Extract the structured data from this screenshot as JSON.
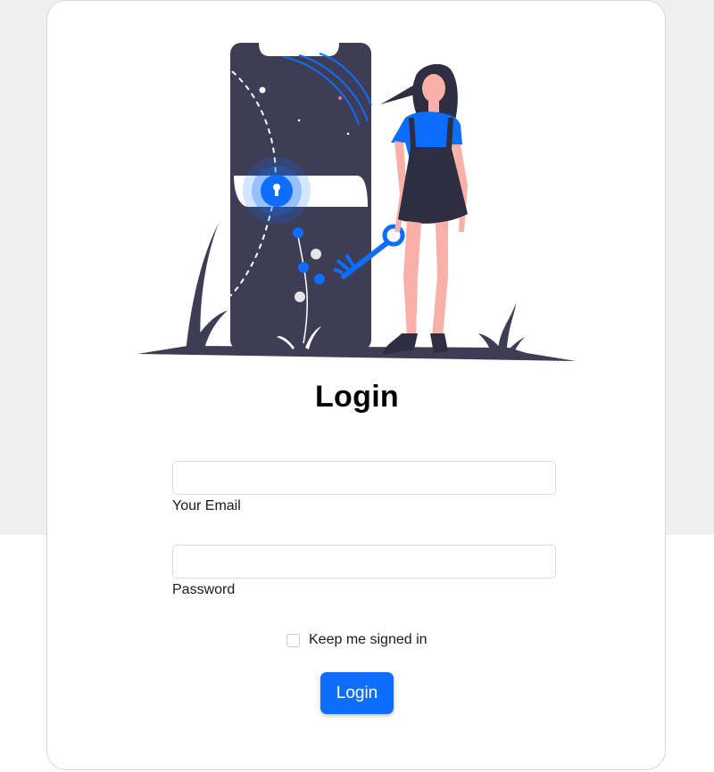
{
  "page": {
    "title": "Login"
  },
  "form": {
    "email": {
      "value": "",
      "label": "Your Email"
    },
    "password": {
      "value": "",
      "label": "Password"
    },
    "remember": {
      "label": "Keep me signed in",
      "checked": false
    },
    "submit_label": "Login"
  },
  "illustration": {
    "name": "secure-login-illustration",
    "colors": {
      "dark": "#3f3d56",
      "accent": "#0d6efd",
      "skin": "#f8b0a8",
      "hair": "#2f2e41"
    }
  },
  "colors": {
    "page_background": "#efefef",
    "card_background": "#ffffff",
    "button": "#0d6efd"
  }
}
